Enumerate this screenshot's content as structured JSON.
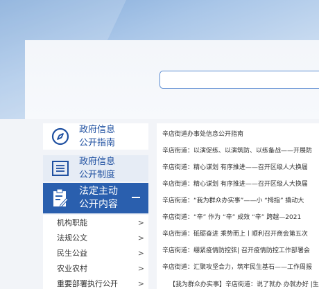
{
  "search": {
    "placeholder": ""
  },
  "sidebar": {
    "items": [
      {
        "icon": "compass-icon",
        "line1": "政府信息",
        "line2": "公开指南"
      },
      {
        "icon": "list-icon",
        "line1": "政府信息",
        "line2": "公开制度"
      },
      {
        "icon": "clipboard-edit-icon",
        "line1": "法定主动",
        "line2": "公开内容"
      }
    ],
    "subitems": [
      {
        "label": "机构职能",
        "chevron": ">"
      },
      {
        "label": "法规公文",
        "chevron": ">"
      },
      {
        "label": "民生公益",
        "chevron": ">"
      },
      {
        "label": "农业农村",
        "chevron": ">"
      },
      {
        "label": "重要部署执行公开",
        "chevron": ">"
      }
    ]
  },
  "articles": [
    "辛店街道办事处信息公开指南",
    "辛店街道：以演促练、以演筑防、以练备战——开展防",
    "辛店街道：精心谋划 有序推进——召开区级人大换届",
    "辛店街道：精心谋划 有序推进——召开区级人大换届",
    "辛店街道：“我为群众办实事”——小 “拇指” 撬动大",
    "辛店街道：“辛” 作为 “辛” 成效 “辛” 跨越—2021",
    "辛店街道：砥砺奋进 乘势而上丨顺利召开商会第五次",
    "辛店街道：绷紧疫情防控弦| 召开疫情防控工作部署会",
    "辛店街道：汇聚攻坚合力，筑牢民生基石——工作周报",
    "【我为群众办实事】辛店街道：说了就办 办就办好 |生"
  ],
  "colors": {
    "accent": "#2a5fae",
    "link": "#1e4fa0",
    "hero": "#a9c6e8"
  }
}
